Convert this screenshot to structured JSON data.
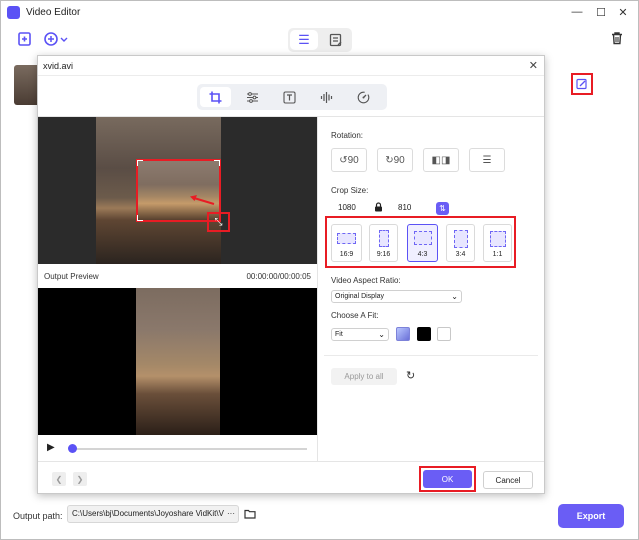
{
  "app": {
    "title": "Video Editor"
  },
  "window_controls": {
    "minimize": "—",
    "maximize": "☐",
    "close": "✕"
  },
  "footer": {
    "output_label": "Output path:",
    "output_path": "C:\\Users\\bj\\Documents\\Joyoshare VidKit\\V",
    "more": "···",
    "export_label": "Export"
  },
  "dialog": {
    "title": "xvid.avi",
    "close": "✕",
    "tabs": [
      {
        "icon": "crop-icon",
        "glyph": "⌗"
      },
      {
        "icon": "adjust-icon",
        "glyph": "☰"
      },
      {
        "icon": "text-icon",
        "glyph": "T"
      },
      {
        "icon": "audio-icon",
        "glyph": "⫼"
      },
      {
        "icon": "speed-icon",
        "glyph": "◔"
      }
    ],
    "preview": {
      "label": "Output Preview",
      "timecode": "00:00:00/00:00:05",
      "progress": 0
    },
    "rotation": {
      "label": "Rotation:",
      "buttons": [
        {
          "icon": "rotate-left-icon",
          "glyph": "↺"
        },
        {
          "icon": "rotate-right-icon",
          "glyph": "↻"
        },
        {
          "icon": "flip-horizontal-icon",
          "glyph": "⇔"
        },
        {
          "icon": "flip-vertical-icon",
          "glyph": "⇕"
        }
      ]
    },
    "crop_size": {
      "label": "Crop Size:",
      "width": "1080",
      "height": "810"
    },
    "ratios": [
      "16:9",
      "9:16",
      "4:3",
      "3:4",
      "1:1"
    ],
    "selected_ratio": "4:3",
    "aspect": {
      "label": "Video Aspect Ratio:",
      "value": "Original Display"
    },
    "fit": {
      "label": "Choose A Fit:",
      "value": "Fit",
      "swatches": [
        "#c9d6ff",
        "#000000",
        "#ffffff"
      ]
    },
    "apply_all": "Apply to all",
    "ok": "OK",
    "cancel": "Cancel"
  },
  "colors": {
    "accent": "#5b52f5",
    "highlight": "#e81c24"
  }
}
